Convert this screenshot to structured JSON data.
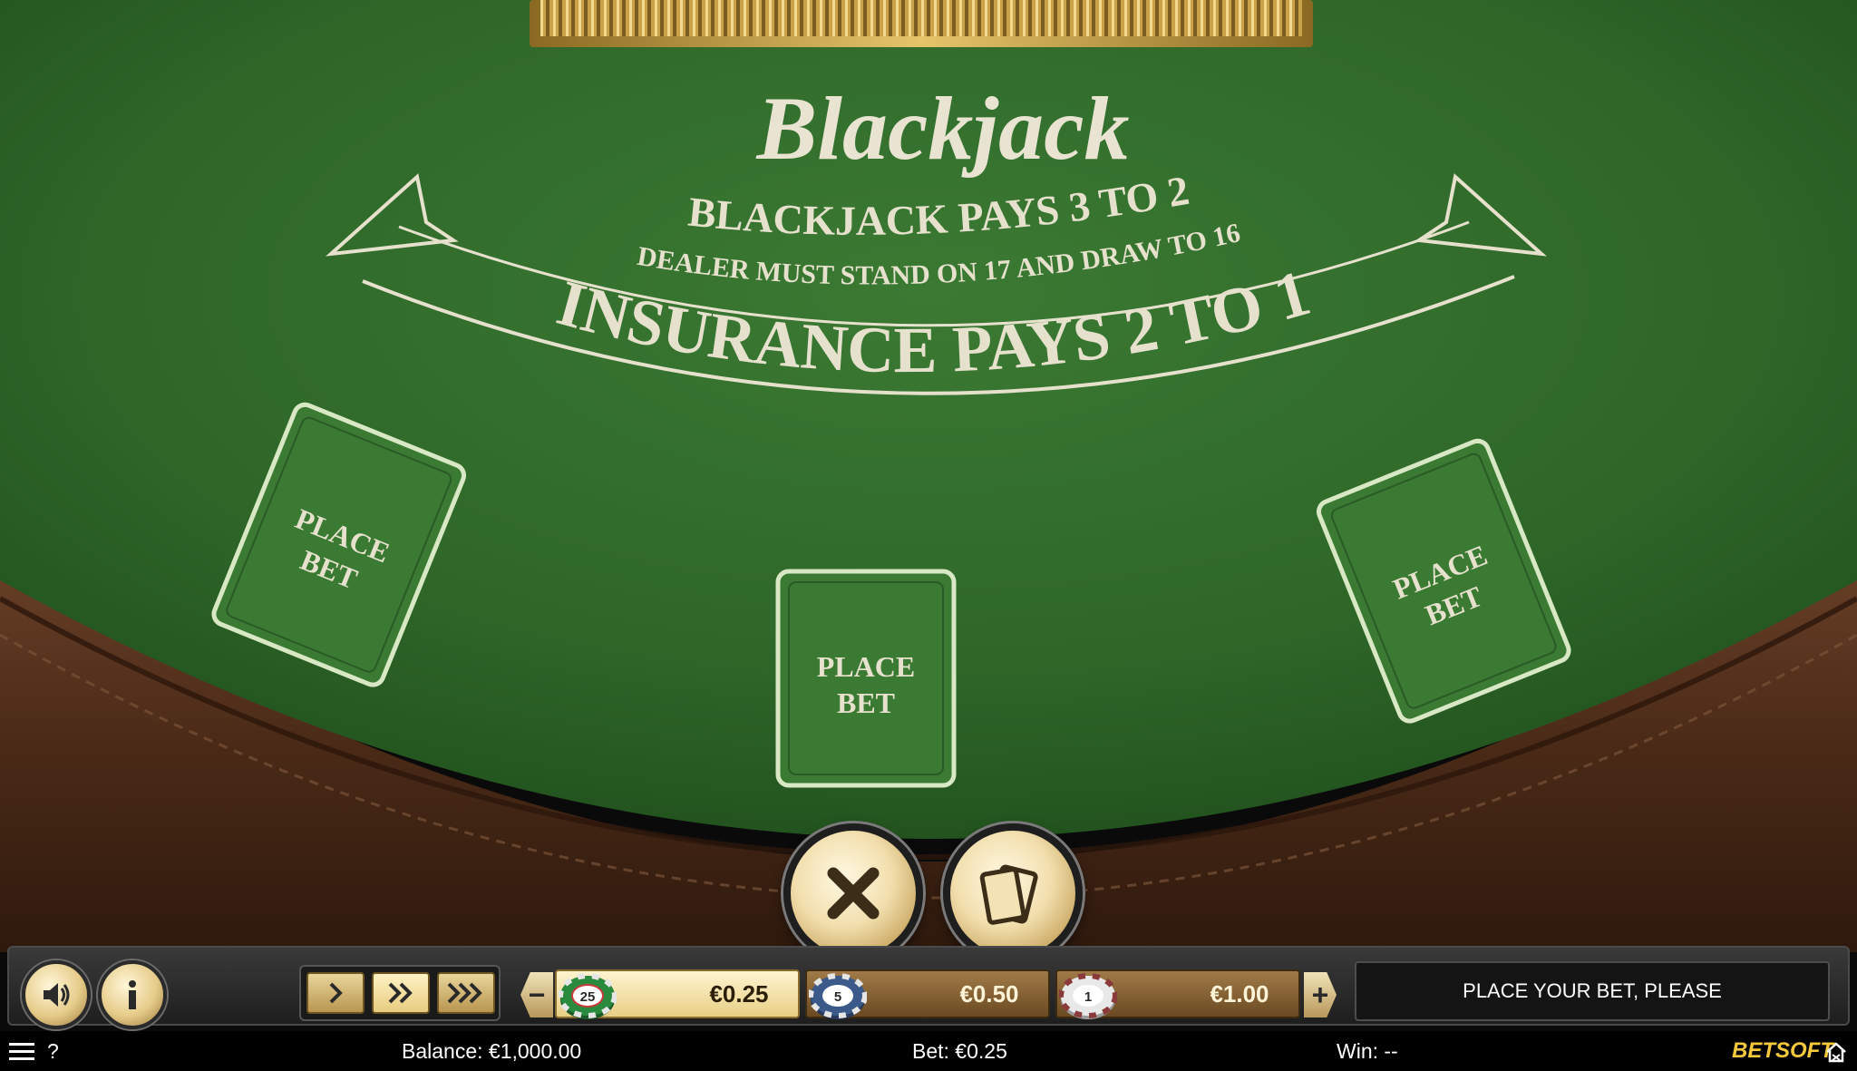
{
  "table": {
    "logo": "Blackjack",
    "rules": {
      "line1": "BLACKJACK PAYS 3 TO 2",
      "line2": "DEALER MUST STAND ON 17 AND DRAW TO 16",
      "insurance": "INSURANCE PAYS 2 TO 1"
    },
    "bet_spots": [
      {
        "line1": "PLACE",
        "line2": "BET"
      },
      {
        "line1": "PLACE",
        "line2": "BET"
      },
      {
        "line1": "PLACE",
        "line2": "BET"
      }
    ],
    "colors": {
      "felt": "#2f6a2a",
      "felt_dark": "#1f4d1d",
      "rail": "#4a2c1a",
      "gold": "#c9a24a"
    }
  },
  "actions": {
    "clear_icon": "x-icon",
    "deal_icon": "cards-icon"
  },
  "controls": {
    "sound_icon": "speaker-icon",
    "info_icon": "info-icon",
    "speed_icons": [
      "single-chevron-icon",
      "double-chevron-icon",
      "triple-chevron-icon"
    ],
    "decrease_label": "−",
    "increase_label": "+",
    "chips": [
      {
        "label": "25",
        "value": "€0.25",
        "selected": true
      },
      {
        "label": "5",
        "value": "€0.50",
        "selected": false
      },
      {
        "label": "1",
        "value": "€1.00",
        "selected": false
      }
    ],
    "message": "PLACE YOUR BET, PLEASE"
  },
  "status": {
    "menu_icon": "hamburger-icon",
    "help_label": "?",
    "balance": "Balance: €1,000.00",
    "bet": "Bet: €0.25",
    "win": "Win: --",
    "brand": "BETSOFT",
    "home_icon": "home-icon"
  }
}
